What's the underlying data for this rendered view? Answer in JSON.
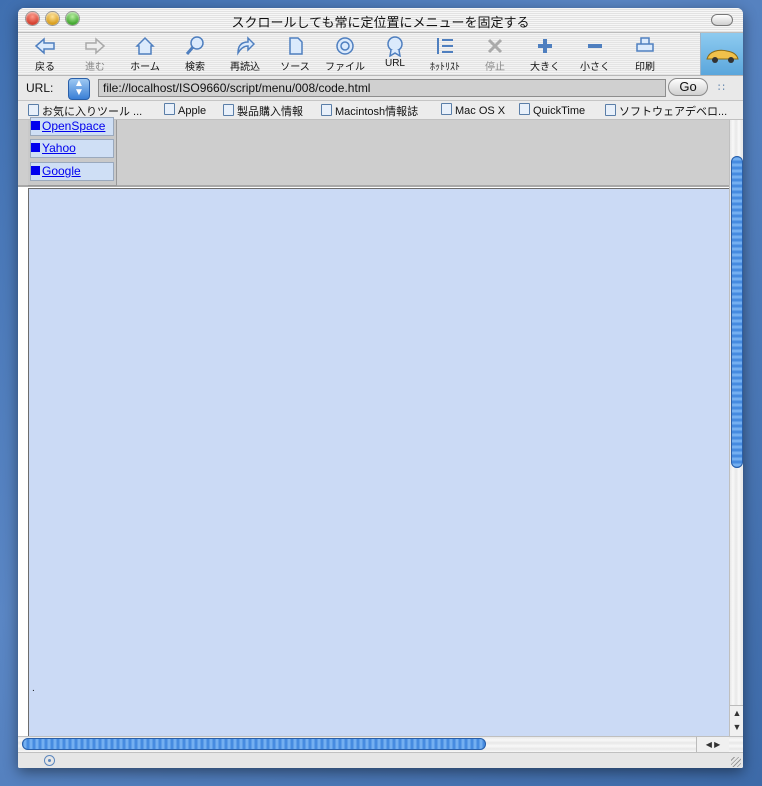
{
  "window": {
    "title": "スクロールしても常に定位置にメニューを固定する"
  },
  "toolbar": {
    "items": [
      {
        "label": "戻る",
        "icon": "back-arrow-icon",
        "enabled": true
      },
      {
        "label": "進む",
        "icon": "forward-arrow-icon",
        "enabled": false
      },
      {
        "label": "ホーム",
        "icon": "home-icon",
        "enabled": true
      },
      {
        "label": "検索",
        "icon": "search-icon",
        "enabled": true
      },
      {
        "label": "再読込",
        "icon": "reload-icon",
        "enabled": true
      },
      {
        "label": "ソース",
        "icon": "source-icon",
        "enabled": true
      },
      {
        "label": "ファイル",
        "icon": "file-icon",
        "enabled": true
      },
      {
        "label": "URL",
        "icon": "url-icon",
        "enabled": true
      },
      {
        "label": "ﾎｯﾄﾘｽﾄ",
        "icon": "hotlist-icon",
        "enabled": true
      },
      {
        "label": "停止",
        "icon": "stop-icon",
        "enabled": false
      },
      {
        "label": "大きく",
        "icon": "plus-icon",
        "enabled": true
      },
      {
        "label": "小さく",
        "icon": "minus-icon",
        "enabled": true
      },
      {
        "label": "印刷",
        "icon": "print-icon",
        "enabled": true
      }
    ]
  },
  "urlbar": {
    "label": "URL:",
    "value": "file://localhost/ISO9660/script/menu/008/code.html",
    "go_label": "Go"
  },
  "favorites": [
    "お気に入りツール ...",
    "Apple",
    "製品購入情報",
    "Macintosh情報誌",
    "Mac OS X",
    "QuickTime",
    "ソフトウェアデベロ..."
  ],
  "menu": {
    "items": [
      "OpenSpace",
      "Yahoo",
      "Google"
    ]
  },
  "main": {
    "text": "."
  },
  "colors": {
    "frame_bg": "#cbdaf5",
    "link": "#0000ee",
    "scroll_thumb": "#3b82dc"
  }
}
